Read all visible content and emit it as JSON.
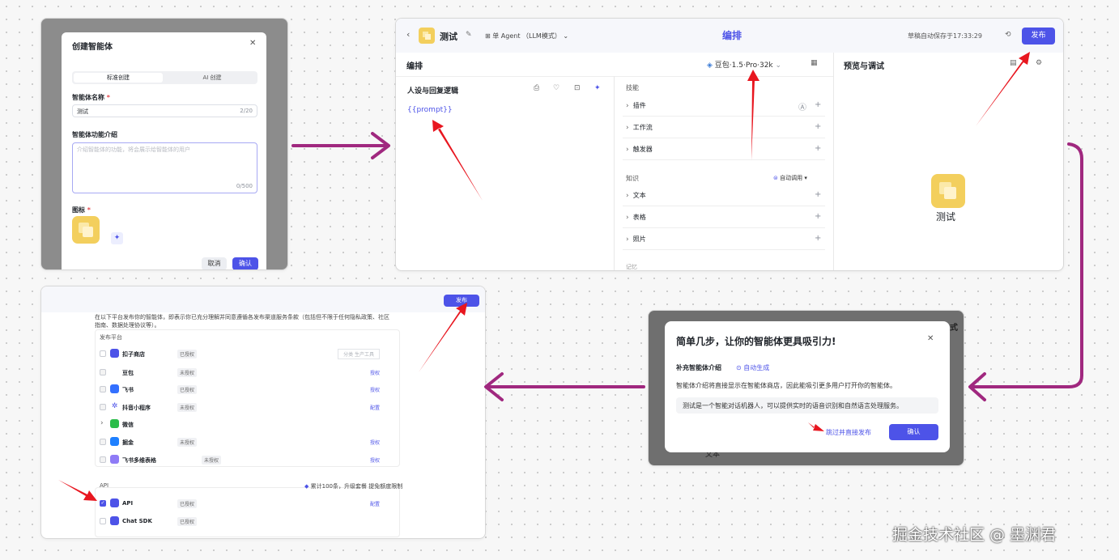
{
  "create": {
    "title": "创建智能体",
    "tabs": [
      "标准创建",
      "AI 创建"
    ],
    "name_label": "智能体名称",
    "name_value": "测试",
    "name_count": "2/20",
    "desc_label": "智能体功能介绍",
    "desc_placeholder": "介绍智能体的功能，将会展示给智能体的用户",
    "desc_count": "0/500",
    "icon_label": "图标",
    "cancel": "取消",
    "confirm": "确认"
  },
  "editor": {
    "bot_name": "测试",
    "mode": "单 Agent （LLM模式）",
    "center_title": "编排",
    "autosave": "草稿自动保存于17:33:29",
    "publish": "发布",
    "section_title": "编排",
    "model": "豆包·1.5·Pro·32k",
    "persona_title": "人设与回复逻辑",
    "prompt": "{{prompt}}",
    "skills_title": "技能",
    "skills": [
      "插件",
      "工作流",
      "触发器"
    ],
    "knowledge_title": "知识",
    "auto_call": "自动调用",
    "knowledge": [
      "文本",
      "表格",
      "照片"
    ],
    "more": "记忆",
    "preview_title": "预览与调试",
    "preview_name": "测试"
  },
  "publish": {
    "button": "发布",
    "notice": "在以下平台发布你的智能体，即表示你已充分理解并同意遵循各发布渠道服务条款（包括但不限于任何隐私政策、社区指南、数据处理协议等）。",
    "platform_title": "发布平台",
    "platforms": [
      {
        "name": "扣子商店",
        "status": "已授权",
        "action": "分类  生产工具"
      },
      {
        "name": "豆包",
        "status": "未授权",
        "action": "授权"
      },
      {
        "name": "飞书",
        "status": "已授权",
        "action": "授权"
      },
      {
        "name": "抖音小程序",
        "status": "未授权",
        "action": "配置"
      },
      {
        "name": "微信",
        "status": "",
        "action": ""
      },
      {
        "name": "掘金",
        "status": "未授权",
        "action": "授权"
      },
      {
        "name": "飞书多维表格",
        "status": "未授权",
        "action": "授权"
      }
    ],
    "api_title": "API",
    "api_quota": "累计100条，升级套餐 提免额度限制",
    "apis": [
      {
        "name": "API",
        "status": "已授权",
        "action": "配置"
      },
      {
        "name": "Chat SDK",
        "status": "已授权",
        "action": ""
      }
    ],
    "colors": {
      "primary": "#4d53e8",
      "arrow_red": "#e8161f",
      "arrow_purple": "#a0287f"
    }
  },
  "supplement": {
    "title": "简单几步，让你的智能体更具吸引力!",
    "section": "补充智能体介绍",
    "auto_gen": "自动生成",
    "desc": "智能体介绍将直接显示在智能体商店，因此能吸引更多用户打开你的智能体。",
    "content": "测试是一个智能对话机器人，可以提供实时的语音识别和自然语言处理服务。",
    "skip": "跳过并直接发布",
    "confirm": "确认",
    "behind_text": "文本"
  },
  "watermark": "掘金技术社区 @ 墨渊君"
}
